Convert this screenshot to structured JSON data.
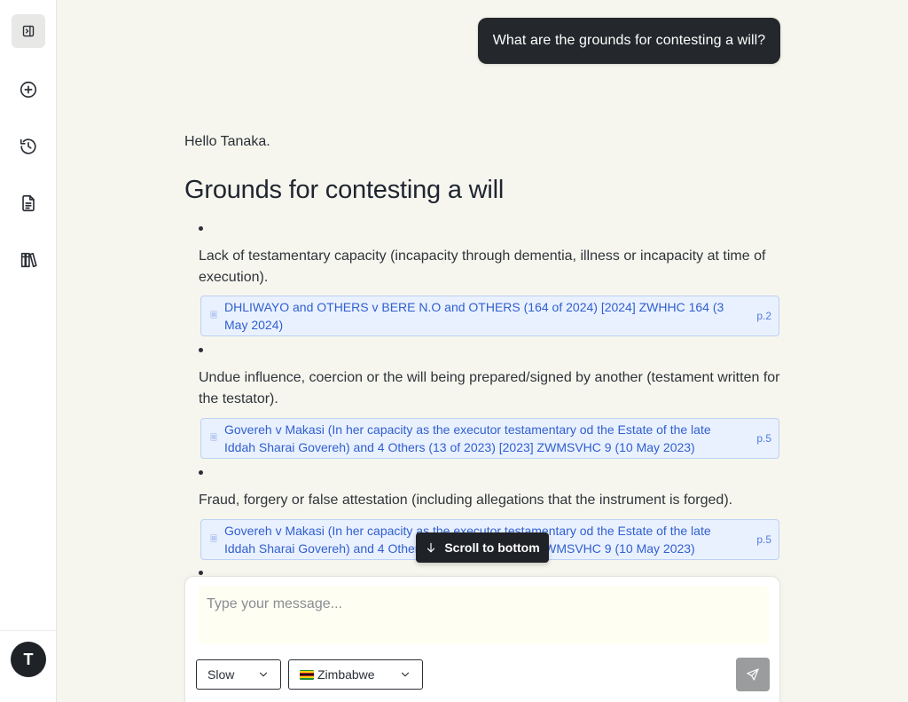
{
  "sidebar": {
    "items": [
      {
        "icon": "sidebar-toggle-icon",
        "active": true
      },
      {
        "icon": "new-chat-icon"
      },
      {
        "icon": "history-icon"
      },
      {
        "icon": "document-icon"
      },
      {
        "icon": "library-icon"
      }
    ],
    "avatar_initial": "T"
  },
  "conversation": {
    "user_message": "What are the grounds for contesting a will?",
    "greeting": "Hello Tanaka.",
    "heading": "Grounds for contesting a will",
    "points": [
      {
        "text": "Lack of testamentary capacity (incapacity through dementia, illness or incapacity at time of execution).",
        "citation": {
          "icon": "judgment-document-icon",
          "title": "DHLIWAYO and OTHERS v BERE N.O and OTHERS (164 of 2024) [2024] ZWHHC 164 (3 May 2024)",
          "page": "p.2"
        }
      },
      {
        "text": "Undue influence, coercion or the will being prepared/signed by another (testament written for the testator).",
        "citation": {
          "icon": "judgment-document-icon",
          "title": "Govereh v Makasi (In her capacity as the executor testamentary od the Estate of the late Iddah Sharai Govereh) and 4 Others (13 of 2023) [2023] ZWMSVHC 9 (10 May 2023)",
          "page": "p.5"
        }
      },
      {
        "text": "Fraud, forgery or false attestation (including allegations that the instrument is forged).",
        "citation": {
          "icon": "judgment-document-icon",
          "title": "Govereh v Makasi (In her capacity as the executor testamentary od the Estate of the late Iddah Sharai Govereh) and 4 Others (13 of 2023) [2023] ZWMSVHC 9 (10 May 2023)",
          "page": "p.5"
        }
      }
    ]
  },
  "scroll_button": {
    "label": "Scroll to bottom"
  },
  "composer": {
    "placeholder": "Type your message...",
    "speed_select": {
      "value": "Slow"
    },
    "country_select": {
      "value": "Zimbabwe",
      "flag": "zimbabwe-flag-icon"
    },
    "send_icon": "send-icon"
  },
  "colors": {
    "background": "#f6f6ee",
    "user_bubble": "#24282c",
    "citation_bg": "#eaf1fe",
    "citation_text": "#2f5fd0",
    "send_button": "#9a9c9d"
  }
}
